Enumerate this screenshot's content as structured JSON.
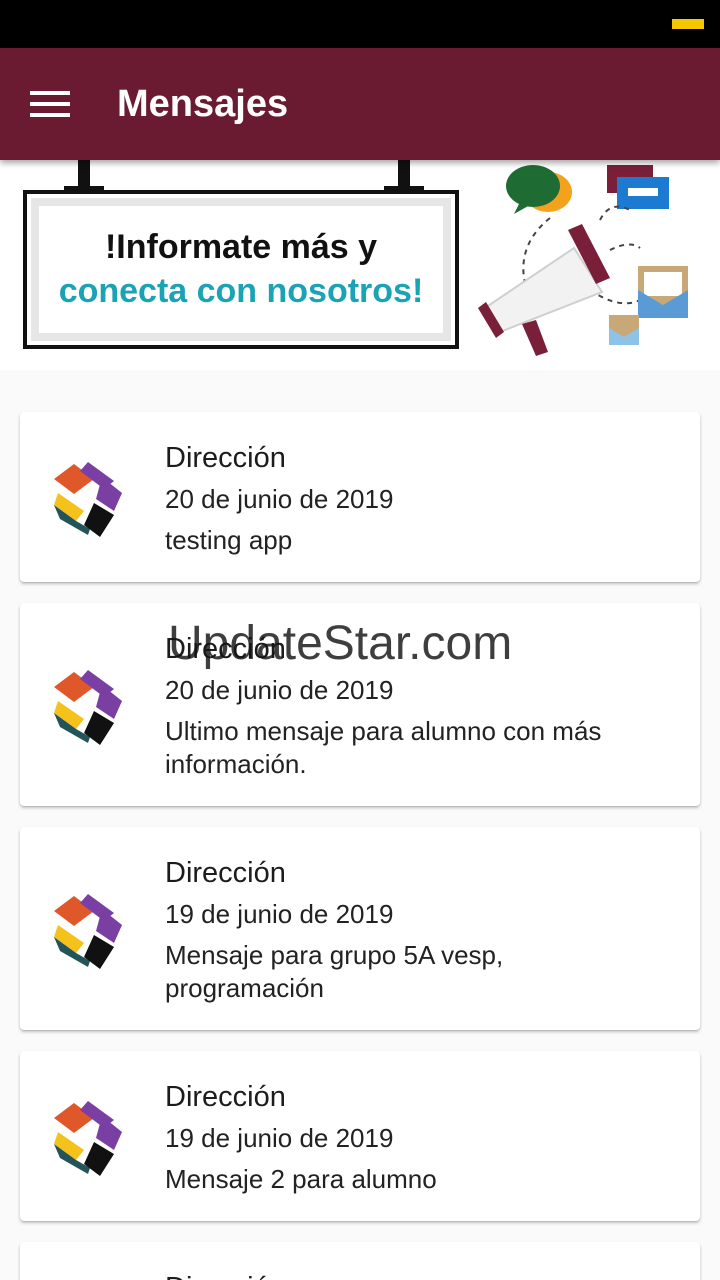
{
  "app_bar": {
    "title": "Mensajes",
    "menu_icon": "hamburger-menu-icon",
    "background": "#6a1b31"
  },
  "banner": {
    "line1": "!Informate más y",
    "line2": "conecta con nosotros!",
    "line2_color": "#1aa3b5",
    "illustration_icon": "megaphone-icon"
  },
  "messages": [
    {
      "sender": "Dirección",
      "date": "20 de junio de 2019",
      "text": "testing app"
    },
    {
      "sender": "Dirección",
      "date": "20 de junio de 2019",
      "text": "Ultimo mensaje para alumno con más información."
    },
    {
      "sender": "Dirección",
      "date": "19 de junio de 2019",
      "text": "Mensaje para grupo 5A vesp, programación"
    },
    {
      "sender": "Dirección",
      "date": "19 de junio de 2019",
      "text": "Mensaje 2 para alumno"
    },
    {
      "sender": "Dirección",
      "date": "",
      "text": ""
    }
  ],
  "watermark": "UpdateStar.com"
}
